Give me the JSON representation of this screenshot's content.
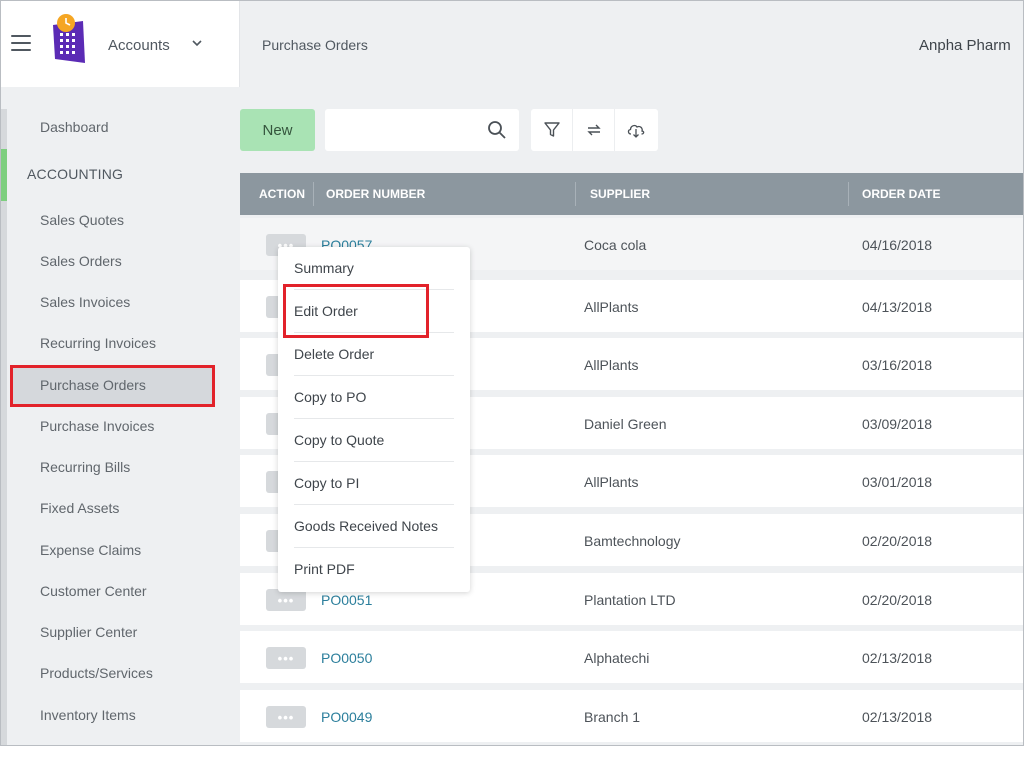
{
  "app": {
    "name": "Accounts",
    "page_title": "Purchase Orders",
    "company": "Anpha Pharm"
  },
  "sidebar": {
    "section": "ACCOUNTING",
    "items": [
      {
        "label": "Dashboard"
      },
      {
        "label": "Sales Quotes"
      },
      {
        "label": "Sales Orders"
      },
      {
        "label": "Sales Invoices"
      },
      {
        "label": "Recurring Invoices"
      },
      {
        "label": "Purchase Orders",
        "active": true
      },
      {
        "label": "Purchase Invoices"
      },
      {
        "label": "Recurring Bills"
      },
      {
        "label": "Fixed Assets"
      },
      {
        "label": "Expense Claims"
      },
      {
        "label": "Customer Center"
      },
      {
        "label": "Supplier Center"
      },
      {
        "label": "Products/Services"
      },
      {
        "label": "Inventory Items"
      }
    ]
  },
  "toolbar": {
    "new_label": "New",
    "search_value": "",
    "icons": [
      "filter-icon",
      "refresh-icon",
      "cloud-download-icon"
    ]
  },
  "table": {
    "headers": [
      "ACTION",
      "ORDER NUMBER",
      "SUPPLIER",
      "ORDER DATE"
    ],
    "action_label": "•••",
    "rows": [
      {
        "order": "PO0057",
        "supplier": "Coca cola",
        "date": "04/16/2018"
      },
      {
        "order": "",
        "supplier": "AllPlants",
        "date": "04/13/2018"
      },
      {
        "order": "",
        "supplier": "AllPlants",
        "date": "03/16/2018"
      },
      {
        "order": "",
        "supplier": "Daniel Green",
        "date": "03/09/2018"
      },
      {
        "order": "",
        "supplier": "AllPlants",
        "date": "03/01/2018"
      },
      {
        "order": "",
        "supplier": "Bamtechnology",
        "date": "02/20/2018"
      },
      {
        "order": "PO0051",
        "supplier": "Plantation LTD",
        "date": "02/20/2018"
      },
      {
        "order": "PO0050",
        "supplier": "Alphatechi",
        "date": "02/13/2018"
      },
      {
        "order": "PO0049",
        "supplier": "Branch 1",
        "date": "02/13/2018"
      }
    ]
  },
  "context_menu": {
    "items": [
      {
        "label": "Summary"
      },
      {
        "label": "Edit Order",
        "highlighted": true
      },
      {
        "label": "Delete Order"
      },
      {
        "label": "Copy to PO"
      },
      {
        "label": "Copy to Quote"
      },
      {
        "label": "Copy to PI"
      },
      {
        "label": "Goods Received Notes"
      },
      {
        "label": "Print PDF"
      }
    ]
  },
  "colors": {
    "accent_green": "#a9e3b4",
    "link_blue": "#2c7f9c",
    "header_gray": "#8c979f",
    "highlight_red": "#e2222a",
    "logo_purple": "#5b2bb5",
    "logo_orange": "#f5a623"
  }
}
